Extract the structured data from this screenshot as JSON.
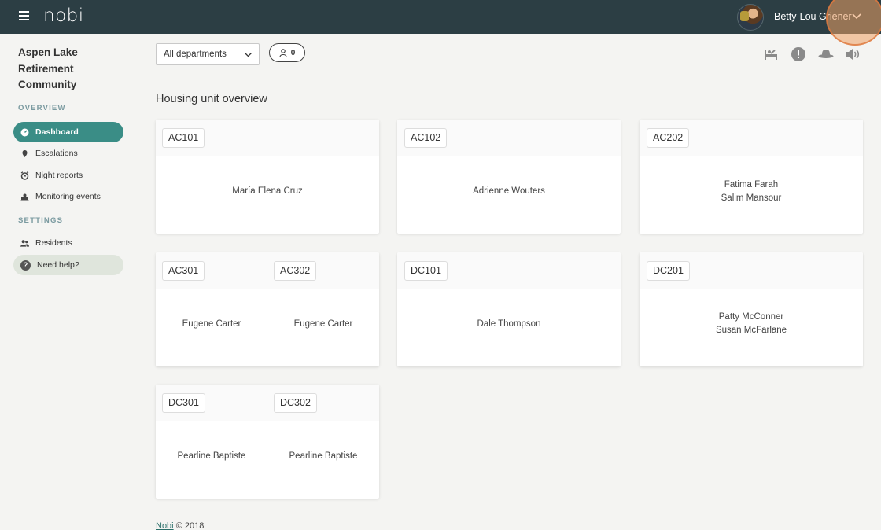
{
  "topbar": {
    "logo": "nobi",
    "user_name": "Betty-Lou Griener"
  },
  "sidebar": {
    "org_name": "Aspen Lake Retirement Community",
    "overview_label": "OVERVIEW",
    "settings_label": "SETTINGS",
    "items": [
      {
        "label": "Dashboard",
        "icon": "dashboard-icon"
      },
      {
        "label": "Escalations",
        "icon": "escalation-icon"
      },
      {
        "label": "Night reports",
        "icon": "alarm-clock-icon"
      },
      {
        "label": "Monitoring events",
        "icon": "monitoring-icon"
      },
      {
        "label": "Residents",
        "icon": "people-icon"
      },
      {
        "label": "Need help?",
        "icon": "help-icon"
      }
    ]
  },
  "filters": {
    "department_selected": "All departments",
    "resident_count": "0"
  },
  "page_title": "Housing unit overview",
  "units": [
    {
      "tags": [
        "AC101"
      ],
      "residents": [
        "María Elena Cruz"
      ]
    },
    {
      "tags": [
        "AC102"
      ],
      "residents": [
        "Adrienne Wouters"
      ]
    },
    {
      "tags": [
        "AC202"
      ],
      "residents": [
        "Fatima Farah",
        "Salim Mansour"
      ]
    },
    {
      "tags": [
        "AC301",
        "AC302"
      ],
      "residents": [
        "Eugene Carter",
        "Eugene Carter"
      ]
    },
    {
      "tags": [
        "DC101"
      ],
      "residents": [
        "Dale Thompson"
      ]
    },
    {
      "tags": [
        "DC201"
      ],
      "residents": [
        "Patty McConner",
        "Susan McFarlane"
      ]
    },
    {
      "tags": [
        "DC301",
        "DC302"
      ],
      "residents": [
        "Pearline Baptiste",
        "Pearline Baptiste"
      ]
    }
  ],
  "footer": {
    "link": "Nobi",
    "copyright": "© 2018"
  },
  "colors": {
    "topbar": "#2c3e44",
    "accent": "#3a8d86",
    "background": "#f4f4f2"
  }
}
